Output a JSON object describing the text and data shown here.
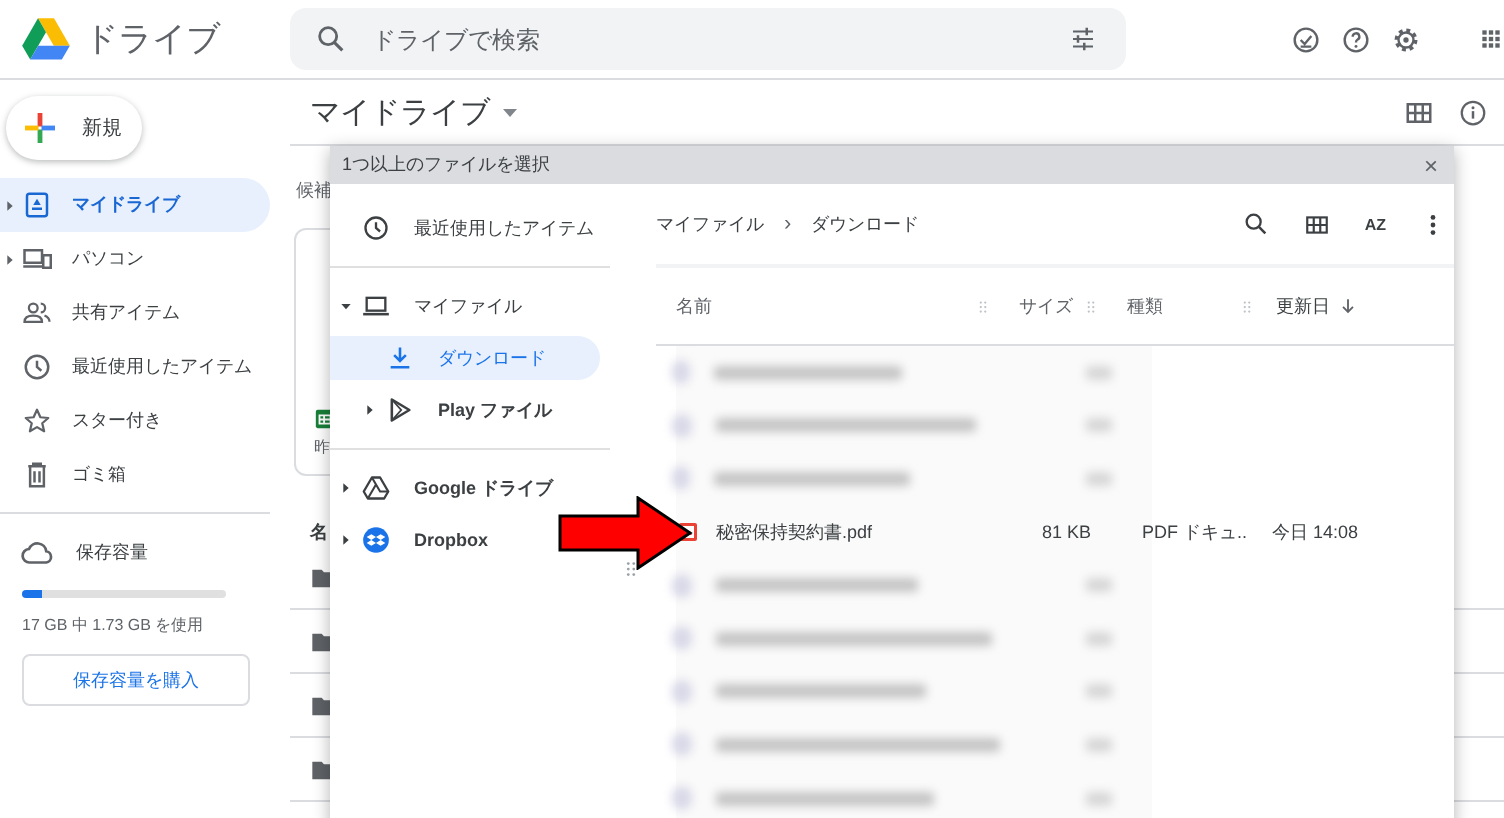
{
  "header": {
    "app_name": "ドライブ",
    "search": {
      "placeholder": "ドライブで検索"
    }
  },
  "sidebar": {
    "new_button": "新規",
    "items": [
      {
        "label": "マイドライブ",
        "expandable": true,
        "selected": true
      },
      {
        "label": "パソコン",
        "expandable": true,
        "selected": false
      },
      {
        "label": "共有アイテム",
        "expandable": false,
        "selected": false
      },
      {
        "label": "最近使用したアイテム",
        "expandable": false,
        "selected": false
      },
      {
        "label": "スター付き",
        "expandable": false,
        "selected": false
      },
      {
        "label": "ゴミ箱",
        "expandable": false,
        "selected": false
      }
    ],
    "storage": {
      "label": "保存容量",
      "level": 0.1,
      "usage": "17 GB 中 1.73 GB を使用",
      "buy_button": "保存容量を購入"
    }
  },
  "main": {
    "title": "マイドライブ",
    "suggested_label": "候補",
    "card_caption": "昨",
    "list_header": "名"
  },
  "dialog": {
    "title": "1つ以上のファイルを選択",
    "close": "×",
    "nav": [
      {
        "label": "最近使用したアイテム",
        "selected": false
      },
      {
        "label": "マイファイル",
        "expanded": true,
        "selected": false,
        "children": [
          {
            "label": "ダウンロード",
            "selected": true
          },
          {
            "label": "Play ファイル",
            "expanded": false,
            "selected": false
          }
        ]
      },
      {
        "label": "Google ドライブ",
        "expanded": false,
        "selected": false
      },
      {
        "label": "Dropbox",
        "expanded": false,
        "selected": false
      }
    ],
    "breadcrumb": [
      "マイファイル",
      "ダウンロード"
    ],
    "breadcrumb_separator": "›",
    "sort_button": "AZ",
    "columns": [
      {
        "label": "名前",
        "sorted": false
      },
      {
        "label": "サイズ",
        "sorted": false
      },
      {
        "label": "種類",
        "sorted": false
      },
      {
        "label": "更新日",
        "sorted": true
      }
    ],
    "files": [
      {
        "kind": "blurred"
      },
      {
        "kind": "blurred"
      },
      {
        "kind": "blurred"
      },
      {
        "kind": "pdf",
        "name": "秘密保持契約書.pdf",
        "size": "81 KB",
        "type": "PDF ドキュ..",
        "modified": "今日 14:08"
      },
      {
        "kind": "blurred"
      },
      {
        "kind": "blurred"
      },
      {
        "kind": "blurred"
      },
      {
        "kind": "blurred"
      },
      {
        "kind": "blurred"
      }
    ]
  }
}
